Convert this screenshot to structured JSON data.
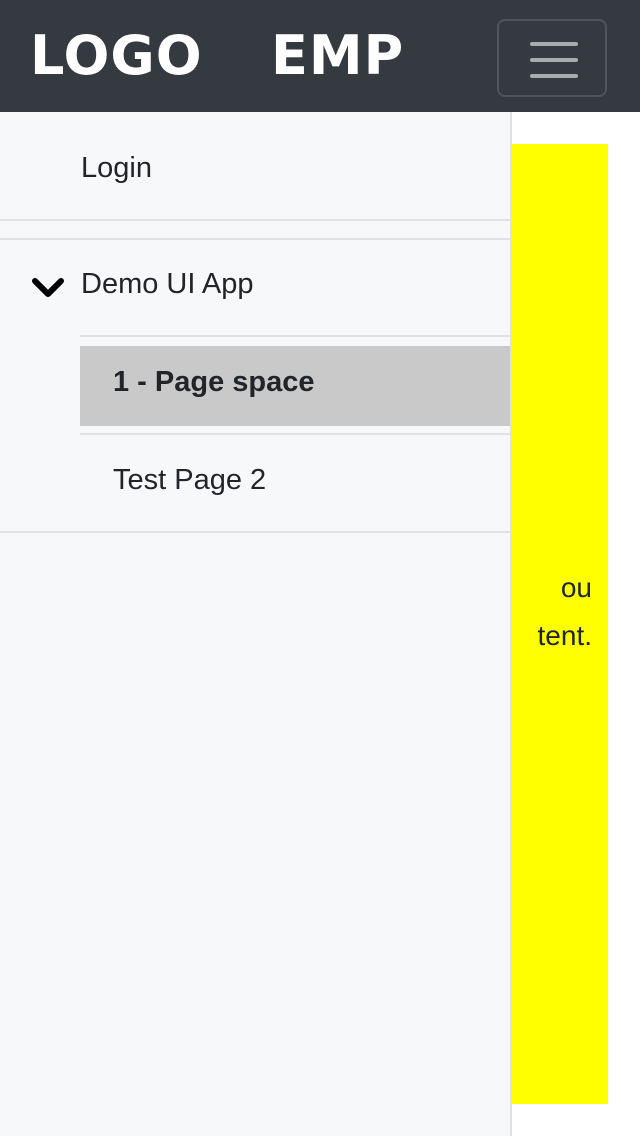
{
  "navbar": {
    "logo_text": "LOGO",
    "brand_text": "EMP",
    "menu_toggle_icon": "hamburger-icon"
  },
  "sidebar": {
    "login_label": "Login",
    "app_group": {
      "expand_icon": "chevron-down-icon",
      "label": "Demo UI App",
      "pages": [
        {
          "label": "1 - Page space",
          "active": true
        },
        {
          "label": "Test Page 2",
          "active": false
        }
      ]
    }
  },
  "content": {
    "background_color": "#ffff00",
    "text_line_1": "ou",
    "text_line_2": "tent."
  },
  "colors": {
    "navbar_bg": "#343a40",
    "sidebar_bg": "#f7f8fa",
    "active_item_bg": "#c9c9c9"
  }
}
